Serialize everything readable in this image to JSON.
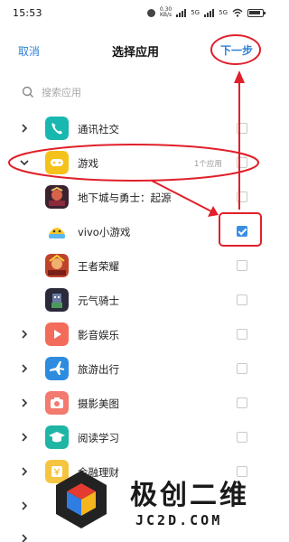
{
  "status_bar": {
    "time": "15:53",
    "speed": "0.30\nKB/s",
    "network": "5G",
    "network2": "5G"
  },
  "header": {
    "cancel_label": "取消",
    "title": "选择应用",
    "next_label": "下一步"
  },
  "search": {
    "placeholder": "搜索应用"
  },
  "categories": [
    {
      "label": "通讯社交",
      "icon": "phone-icon"
    },
    {
      "label": "游戏",
      "icon": "gamepad-icon",
      "count": "1个应用",
      "expanded": true
    },
    {
      "label": "影音娱乐",
      "icon": "play-icon"
    },
    {
      "label": "旅游出行",
      "icon": "airplane-icon"
    },
    {
      "label": "摄影美图",
      "icon": "camera-icon"
    },
    {
      "label": "阅读学习",
      "icon": "graduation-icon"
    },
    {
      "label": "金融理财",
      "icon": "finance-icon"
    }
  ],
  "games": [
    {
      "label": "地下城与勇士：起源",
      "checked": false
    },
    {
      "label": "vivo小游戏",
      "checked": true
    },
    {
      "label": "王者荣耀",
      "checked": false
    },
    {
      "label": "元气骑士",
      "checked": false
    }
  ],
  "checkbox_states": {
    "category_row_checked": [
      false,
      false,
      false,
      true,
      false,
      true,
      false
    ]
  },
  "watermark": {
    "name": "极创二维",
    "url": "JC2D.COM"
  },
  "colors": {
    "accent": "#2f7fd6",
    "checkbox_on": "#3a8ee6",
    "annotation_red": "#e0202a"
  }
}
